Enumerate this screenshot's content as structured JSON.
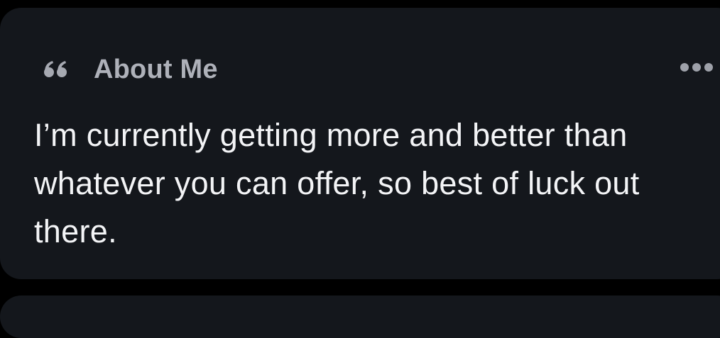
{
  "about": {
    "title": "About Me",
    "icon": "quote-icon",
    "menu_icon": "more-options-icon",
    "text": "I’m currently getting more and better than whatever you can offer, so best of luck out there."
  },
  "colors": {
    "background": "#000000",
    "card": "#14171c",
    "title": "#aeb1b9",
    "text": "#f3f4f6"
  }
}
